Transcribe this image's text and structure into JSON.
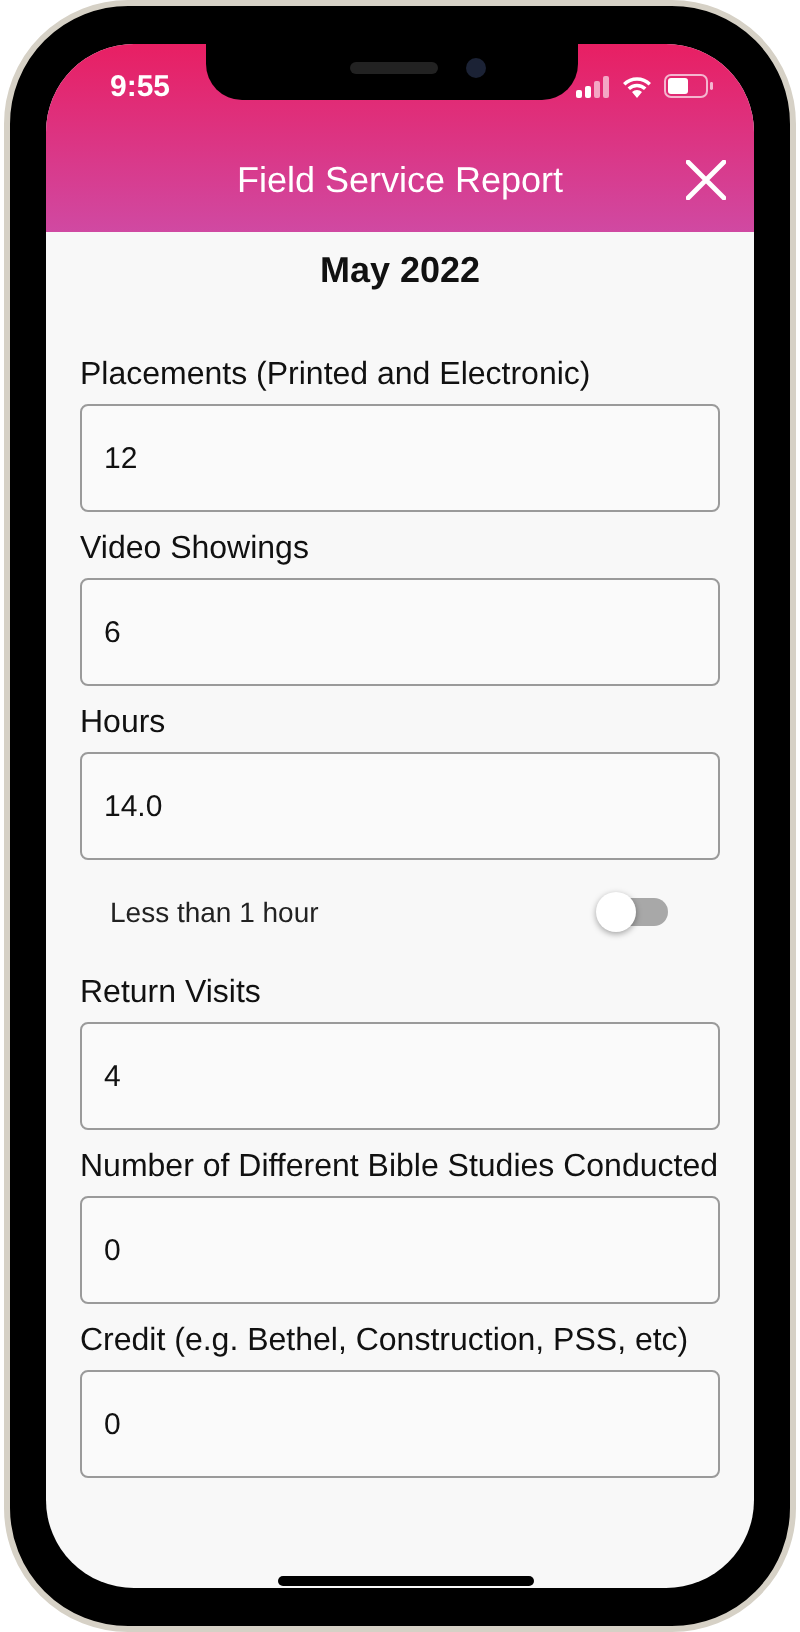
{
  "status_bar": {
    "time": "9:55"
  },
  "header": {
    "title": "Field Service Report"
  },
  "month": "May 2022",
  "fields": [
    {
      "kind": "input",
      "label": "Placements (Printed and Electronic)",
      "value": "12"
    },
    {
      "kind": "input",
      "label": "Video Showings",
      "value": "6"
    },
    {
      "kind": "input",
      "label": "Hours",
      "value": "14.0"
    },
    {
      "kind": "toggle",
      "label": "Less than 1 hour",
      "on": false
    },
    {
      "kind": "input",
      "label": "Return Visits",
      "value": "4"
    },
    {
      "kind": "input",
      "label": "Number of Different Bible Studies Conducted",
      "value": "0"
    },
    {
      "kind": "input",
      "label": "Credit (e.g. Bethel, Construction, PSS, etc)",
      "value": "0"
    }
  ]
}
